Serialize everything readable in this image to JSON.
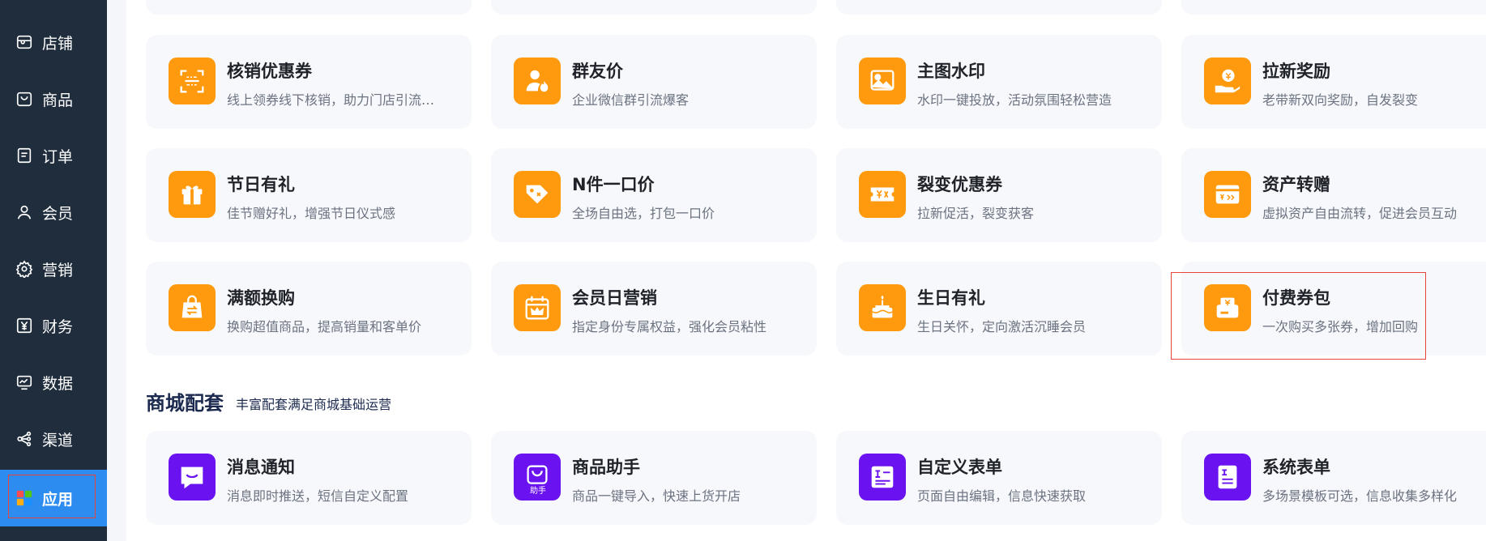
{
  "sidebar": {
    "items": [
      {
        "label": "店铺",
        "icon": "store-icon"
      },
      {
        "label": "商品",
        "icon": "product-bag-icon"
      },
      {
        "label": "订单",
        "icon": "order-doc-icon"
      },
      {
        "label": "会员",
        "icon": "member-user-icon"
      },
      {
        "label": "营销",
        "icon": "marketing-gear-icon"
      },
      {
        "label": "财务",
        "icon": "finance-yen-icon"
      },
      {
        "label": "数据",
        "icon": "data-monitor-icon"
      },
      {
        "label": "渠道",
        "icon": "channel-share-icon"
      },
      {
        "label": "应用",
        "icon": "apps-grid-icon",
        "active": true
      }
    ]
  },
  "marketing_cards": [
    {
      "title": "核销优惠券",
      "desc": "线上领券线下核销，助力门店引流…",
      "icon": "qr-scan-coupon-icon"
    },
    {
      "title": "群友价",
      "desc": "企业微信群引流爆客",
      "icon": "group-user-flame-icon"
    },
    {
      "title": "主图水印",
      "desc": "水印一键投放，活动氛围轻松营造",
      "icon": "image-watermark-icon"
    },
    {
      "title": "拉新奖励",
      "desc": "老带新双向奖励，自发裂变",
      "icon": "hand-coin-icon"
    },
    {
      "title": "节日有礼",
      "desc": "佳节赠好礼，增强节日仪式感",
      "icon": "gift-box-icon"
    },
    {
      "title": "N件一口价",
      "desc": "全场自由选，打包一口价",
      "icon": "price-tag-icon"
    },
    {
      "title": "裂变优惠券",
      "desc": "拉新促活，裂变获客",
      "icon": "split-coupon-icon"
    },
    {
      "title": "资产转赠",
      "desc": "虚拟资产自由流转，促进会员互动",
      "icon": "asset-transfer-icon"
    },
    {
      "title": "满额换购",
      "desc": "换购超值商品，提高销量和客单价",
      "icon": "shopping-bag-exchange-icon"
    },
    {
      "title": "会员日营销",
      "desc": "指定身份专属权益，强化会员粘性",
      "icon": "calendar-crown-icon"
    },
    {
      "title": "生日有礼",
      "desc": "生日关怀，定向激活沉睡会员",
      "icon": "birthday-cake-icon"
    },
    {
      "title": "付费券包",
      "desc": "一次购买多张券，增加回购",
      "icon": "paid-coupon-pack-icon"
    }
  ],
  "mall_section": {
    "title": "商城配套",
    "subtitle": "丰富配套满足商城基础运营",
    "cards": [
      {
        "title": "消息通知",
        "desc": "消息即时推送，短信自定义配置",
        "icon": "message-smile-icon"
      },
      {
        "title": "商品助手",
        "desc": "商品一键导入，快速上货开店",
        "icon": "product-assistant-icon",
        "badge": "助手"
      },
      {
        "title": "自定义表单",
        "desc": "页面自由编辑，信息快速获取",
        "icon": "custom-form-icon"
      },
      {
        "title": "系统表单",
        "desc": "多场景模板可选，信息收集多样化",
        "icon": "system-form-icon"
      }
    ]
  },
  "colors": {
    "sidebar_bg": "#1f2d3d",
    "active_bg": "#2d8cf0",
    "orange_icon": "#ff9a0f",
    "purple_icon": "#6a13f0",
    "card_bg": "#f7f8fb",
    "highlight_border": "#e7453b"
  }
}
